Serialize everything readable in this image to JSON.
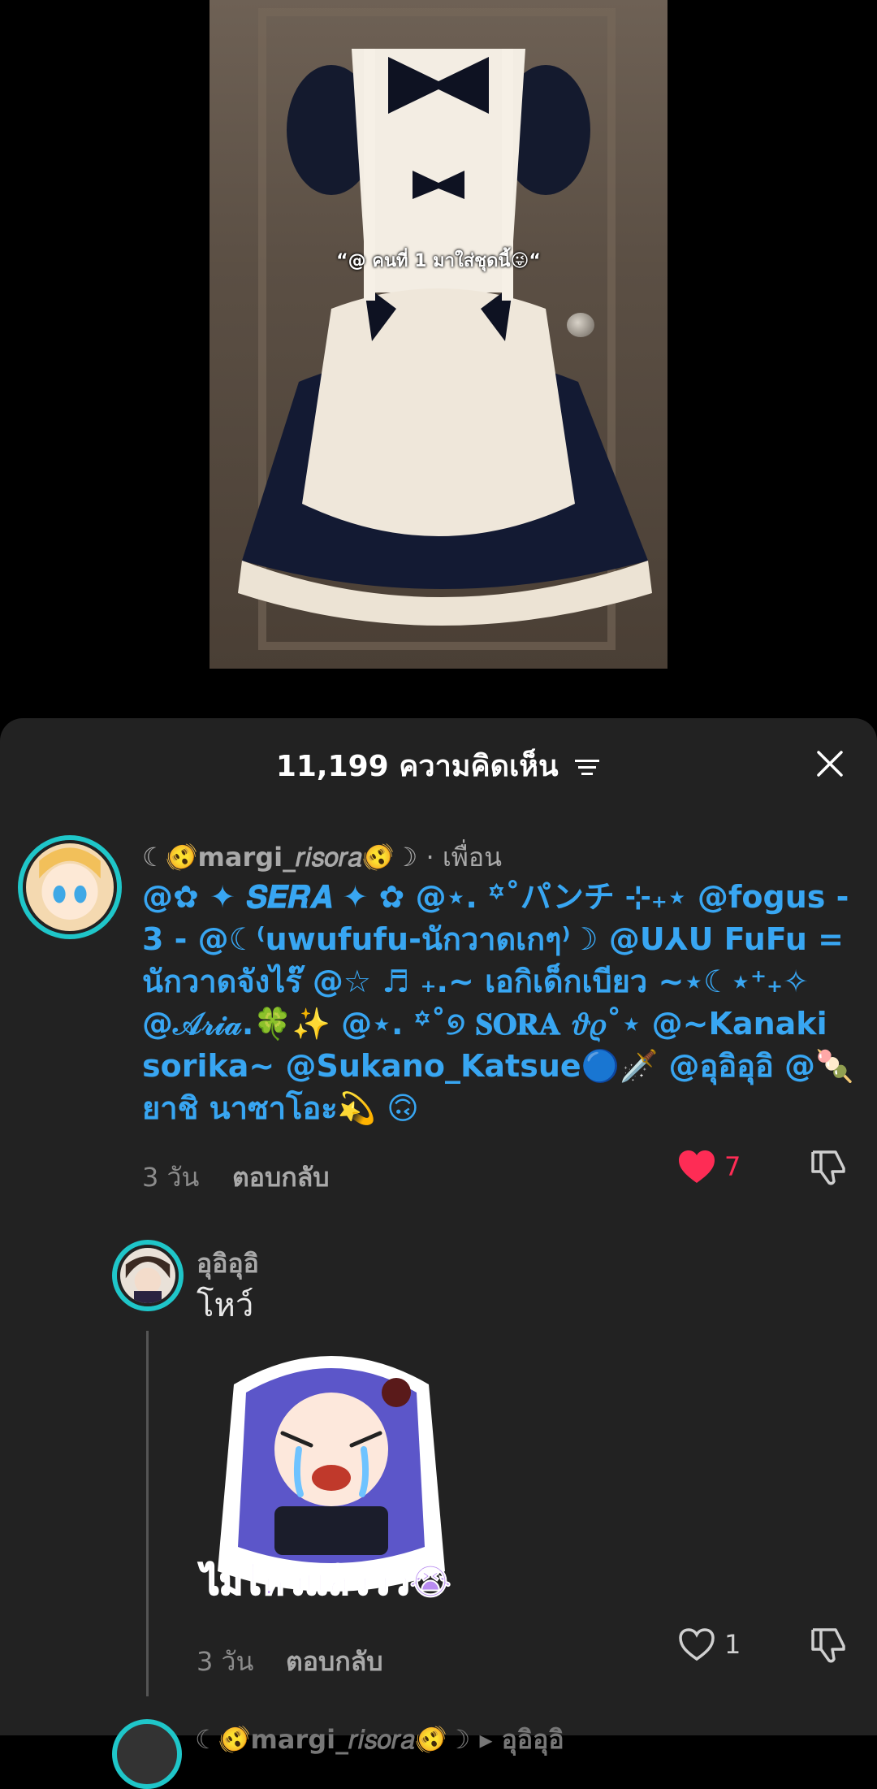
{
  "video": {
    "caption": "“@ คนที่ 1 มาใส่ชุดนี้😜“"
  },
  "comments_panel": {
    "count_title": "11,199 ความคิดเห็น",
    "sort_icon": "sort-icon",
    "close_icon": "close-icon"
  },
  "comment_1": {
    "username": "☾🫨margi_𝑟𝑖𝑠𝑜𝑟𝑎🫨☽",
    "meta": " · เพื่อน",
    "text": "@✿ ✦ 𝑺𝑬𝑹𝑨 ✦ ✿ @⋆. ꙳˚パンチ ⊹₊⋆ @fogus - 3 - @☾⁽uwufufu-นักวาดเกๆ⁾☽ @U⅄U FuFu = นักวาดจังไร๊ @☆ ♬ ₊.~ เอกิเด็กเบียว ~⋆☾⋆⁺₊✧ @𝒜𝓇𝒾𝒶.🍀✨ @⋆. ꙳˚୭ 𝐒𝐎𝐑𝐀 𝜗𝜚˚⋆ @~Kanaki sorika~ @Sukano_Katsue🔵🗡️ @อุอิอุอิ @🍡 ยาชิ นาซาโอะ💫 🙃",
    "time": "3 วัน",
    "reply_label": "ตอบกลับ",
    "likes": "7",
    "liked": true,
    "accent_color": "#38a6f2",
    "like_color": "#fe2c55"
  },
  "reply_1": {
    "username": "อุอิอุอิ",
    "text": "โหว์",
    "sticker_text": "ไม่ไหวแล้ววว😭",
    "time": "3 วัน",
    "reply_label": "ตอบกลับ",
    "likes": "1",
    "liked": false
  },
  "peek_comment": {
    "username": "☾🫨margi_𝑟𝑖𝑠𝑜𝑟𝑎🫨☽ ▸ อุอิอุอิ"
  }
}
